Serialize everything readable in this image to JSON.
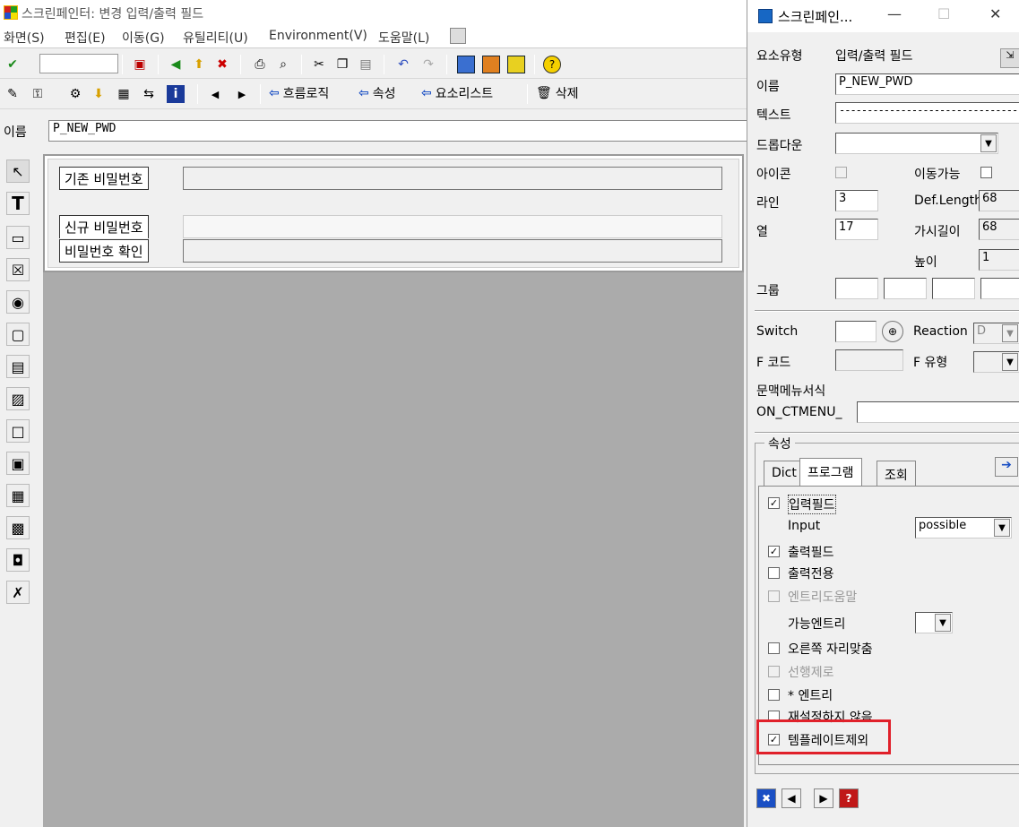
{
  "main": {
    "title": "스크린페인터:  변경 입력/출력 필드",
    "menu": [
      "화면(S)",
      "편집(E)",
      "이동(G)",
      "유틸리티(U)",
      "Environment(V)",
      "도움말(L)"
    ],
    "toolbar2_buttons": {
      "flow_logic": "흐름로직",
      "attributes": "속성",
      "element_list": "요소리스트",
      "delete": "삭제"
    },
    "name_label": "이름",
    "name_value": "P_NEW_PWD",
    "screen_labels": [
      "기존 비밀번호",
      "신규 비밀번호",
      "비밀번호 확인"
    ]
  },
  "dialog": {
    "title": "스크린페인...",
    "element_type_label": "요소유형",
    "element_type_value": "입력/출력 필드",
    "name_label": "이름",
    "name_value": "P_NEW_PWD",
    "text_label": "텍스트",
    "text_value": "----------------------------------------",
    "dropdown_label": "드롭다운",
    "icon_label": "아이콘",
    "movable_label": "이동가능",
    "line_label": "라인",
    "line_value": "3",
    "deflength_label": "Def.Length",
    "deflength_value": "68",
    "column_label": "열",
    "column_value": "17",
    "vislength_label": "가시길이",
    "vislength_value": "68",
    "height_label": "높이",
    "height_value": "1",
    "group_label": "그룹",
    "switch_label": "Switch",
    "reaction_label": "Reaction",
    "reaction_value": "D",
    "fcode_label": "F 코드",
    "ftype_label": "F 유형",
    "ctxmenu_label": "문맥메뉴서식",
    "ctxmenu_prefix": "ON_CTMENU_",
    "attributes_group": "속성",
    "tabs": [
      "Dict",
      "프로그램",
      "조회"
    ],
    "options": {
      "input_field": "입력필드",
      "input_label": "Input",
      "input_value": "possible",
      "output_field": "출력필드",
      "output_only": "출력전용",
      "entry_help": "엔트리도움말",
      "possible_entries": "가능엔트리",
      "right_justify": "오른쪽 자리맞춤",
      "leading_zero": "선행제로",
      "star_entry": "* 엔트리",
      "no_reset": "재설정하지 않음",
      "exclude_template": "템플레이트제외"
    }
  }
}
